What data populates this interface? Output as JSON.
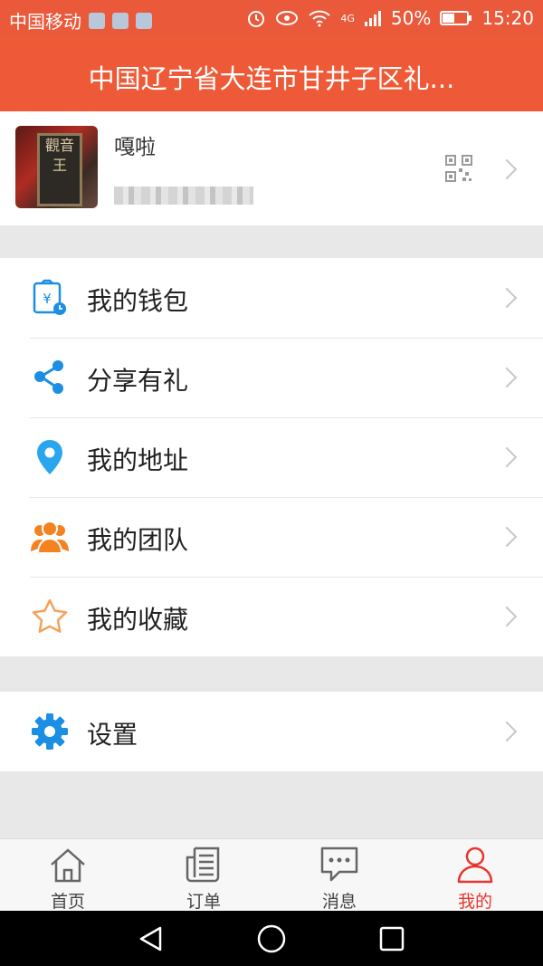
{
  "status_bar": {
    "carrier": "中国移动",
    "network": "4G",
    "battery": "50%",
    "time": "15:20"
  },
  "header": {
    "title": "中国辽宁省大连市甘井子区礼..."
  },
  "profile": {
    "name": "嘎啦",
    "avatar_text": "觀音王"
  },
  "menu_groups": [
    {
      "items": [
        {
          "label": "我的钱包",
          "icon": "wallet-icon"
        },
        {
          "label": "分享有礼",
          "icon": "share-icon"
        },
        {
          "label": "我的地址",
          "icon": "location-pin-icon"
        },
        {
          "label": "我的团队",
          "icon": "team-icon"
        },
        {
          "label": "我的收藏",
          "icon": "star-icon"
        }
      ]
    },
    {
      "items": [
        {
          "label": "设置",
          "icon": "gear-icon"
        }
      ]
    }
  ],
  "tabs": [
    {
      "label": "首页",
      "icon": "home-icon",
      "active": false
    },
    {
      "label": "订单",
      "icon": "orders-icon",
      "active": false
    },
    {
      "label": "消息",
      "icon": "message-icon",
      "active": false
    },
    {
      "label": "我的",
      "icon": "user-icon",
      "active": true
    }
  ],
  "colors": {
    "header": "#ee5a37",
    "active_tab": "#e8352e",
    "icon_blue": "#1a8fe3",
    "icon_orange": "#f58220"
  }
}
